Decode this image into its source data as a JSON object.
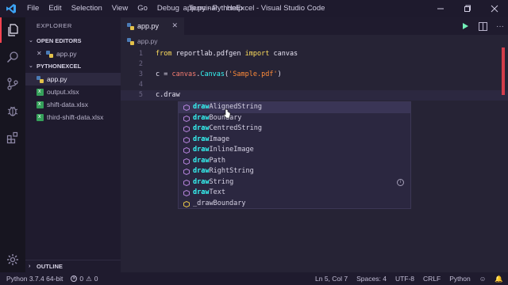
{
  "titlebar": {
    "menu": [
      "File",
      "Edit",
      "Selection",
      "View",
      "Go",
      "Debug",
      "Terminal",
      "Help"
    ],
    "title": "app.py - PythonExcel - Visual Studio Code"
  },
  "sidebar": {
    "header": "EXPLORER",
    "open_editors_label": "OPEN EDITORS",
    "open_editors": [
      {
        "name": "app.py",
        "icon": "python-file-icon"
      }
    ],
    "project_label": "PYTHONEXCEL",
    "files": [
      {
        "name": "app.py",
        "icon": "python-file-icon"
      },
      {
        "name": "output.xlsx",
        "icon": "excel-file-icon"
      },
      {
        "name": "shift-data.xlsx",
        "icon": "excel-file-icon"
      },
      {
        "name": "third-shift-data.xlsx",
        "icon": "excel-file-icon"
      }
    ],
    "outline_label": "OUTLINE"
  },
  "editor": {
    "tab_label": "app.py",
    "breadcrumb": "app.py",
    "line_numbers": [
      "1",
      "2",
      "3",
      "4",
      "5"
    ],
    "lines": {
      "l1": {
        "kw1": "from",
        "mod": "reportlab.pdfgen",
        "kw2": "import",
        "name": "canvas"
      },
      "l3": {
        "var": "c",
        "eq": " = ",
        "obj": "canvas",
        "dot": ".",
        "fn": "Canvas",
        "open": "(",
        "str": "'Sample.pdf'",
        "close": ")"
      },
      "l5": {
        "text": "c.draw"
      }
    }
  },
  "suggestions": [
    {
      "match": "draw",
      "rest": "AlignedString"
    },
    {
      "match": "draw",
      "rest": "Boundary"
    },
    {
      "match": "draw",
      "rest": "CentredString"
    },
    {
      "match": "draw",
      "rest": "Image"
    },
    {
      "match": "draw",
      "rest": "InlineImage"
    },
    {
      "match": "draw",
      "rest": "Path"
    },
    {
      "match": "draw",
      "rest": "RightString"
    },
    {
      "match": "draw",
      "rest": "String"
    },
    {
      "match": "draw",
      "rest": "Text"
    },
    {
      "match": "",
      "rest": "_drawBoundary"
    }
  ],
  "suggest_info": "i",
  "status": {
    "interpreter": "Python 3.7.4 64-bit",
    "errors": "0",
    "warnings": "0",
    "position": "Ln 5, Col 7",
    "spaces": "Spaces: 4",
    "encoding": "UTF-8",
    "eol": "CRLF",
    "language": "Python"
  },
  "colors": {
    "accent": "#fe4450",
    "keyword": "#fede5d",
    "function": "#36f9f6",
    "string": "#ff8b39",
    "variable": "#f97e72"
  }
}
